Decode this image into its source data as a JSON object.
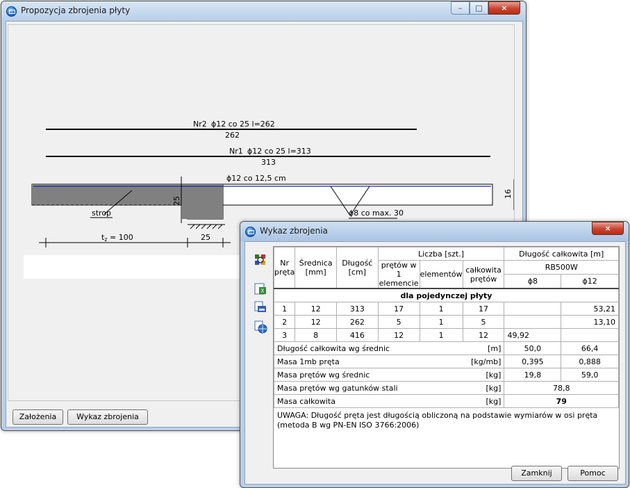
{
  "main_window": {
    "title": "Propozycja zbrojenia płyty",
    "buttons": {
      "zalozenia": "Założenia",
      "wykaz": "Wykaz zbrojenia"
    },
    "drawing": {
      "nr2_label": "Nr2",
      "nr2_spec": "ϕ12 co 25  l=262",
      "nr2_len": "262",
      "nr1_label": "Nr1",
      "nr1_spec": "ϕ12 co 25  l=313",
      "nr1_len": "313",
      "top_bars": "ϕ12 co 12,5 cm",
      "strop": "strop",
      "stirrup": "ϕ8 co max. 30",
      "dim_25_vertical": "25",
      "dim_16": "16",
      "dim_tz": "t",
      "dim_tz_sub": "z",
      "dim_tz_value": " = 100",
      "dim_25": "25"
    }
  },
  "dialog": {
    "title": "Wykaz zbrojenia",
    "header": {
      "nr": "Nr pręta",
      "srednica": "Średnica [mm]",
      "dlugosc": "Długość [cm]",
      "liczba": "Liczba [szt.]",
      "pretow_w": "prętów w 1 elemencie",
      "elementow": "elementów",
      "calkowita": "całkowita prętów",
      "dlugosc_calk": "Długość całkowita [m]",
      "steel": "RB500W",
      "d8": "ϕ8",
      "d12": "ϕ12"
    },
    "section_label": "dla pojedynczej płyty",
    "rows": [
      {
        "nr": "1",
        "d": "12",
        "l": "313",
        "w1": "17",
        "el": "1",
        "cal": "17",
        "p8": "",
        "p12": "53,21"
      },
      {
        "nr": "2",
        "d": "12",
        "l": "262",
        "w1": "5",
        "el": "1",
        "cal": "5",
        "p8": "",
        "p12": "13,10"
      },
      {
        "nr": "3",
        "d": "8",
        "l": "416",
        "w1": "12",
        "el": "1",
        "cal": "12",
        "p8": "49,92",
        "p12": ""
      }
    ],
    "summary": [
      {
        "label": "Długość całkowita wg średnic",
        "unit": "[m]",
        "v8": "50,0",
        "v12": "66,4"
      },
      {
        "label": "Masa 1mb pręta",
        "unit": "[kg/mb]",
        "v8": "0,395",
        "v12": "0,888"
      },
      {
        "label": "Masa prętów wg średnic",
        "unit": "[kg]",
        "v8": "19,8",
        "v12": "59,0"
      }
    ],
    "masa_gatunkow": {
      "label": "Masa prętów wg gatunków stali",
      "unit": "[kg]",
      "value": "78,8"
    },
    "masa_calkowita": {
      "label": "Masa całkowita",
      "unit": "[kg]",
      "value": "79"
    },
    "note": "UWAGA: Długość pręta jest długością obliczoną na podstawie wymiarów w osi pręta (metoda B wg PN-EN ISO 3766:2006)",
    "buttons": {
      "zamknij": "Zamknij",
      "pomoc": "Pomoc"
    },
    "tool_icons": [
      "settings-icon",
      "excel-export-icon",
      "print-icon",
      "web-export-icon"
    ]
  },
  "window_controls": {
    "minimize": "–",
    "maximize": "□",
    "close": "×"
  }
}
